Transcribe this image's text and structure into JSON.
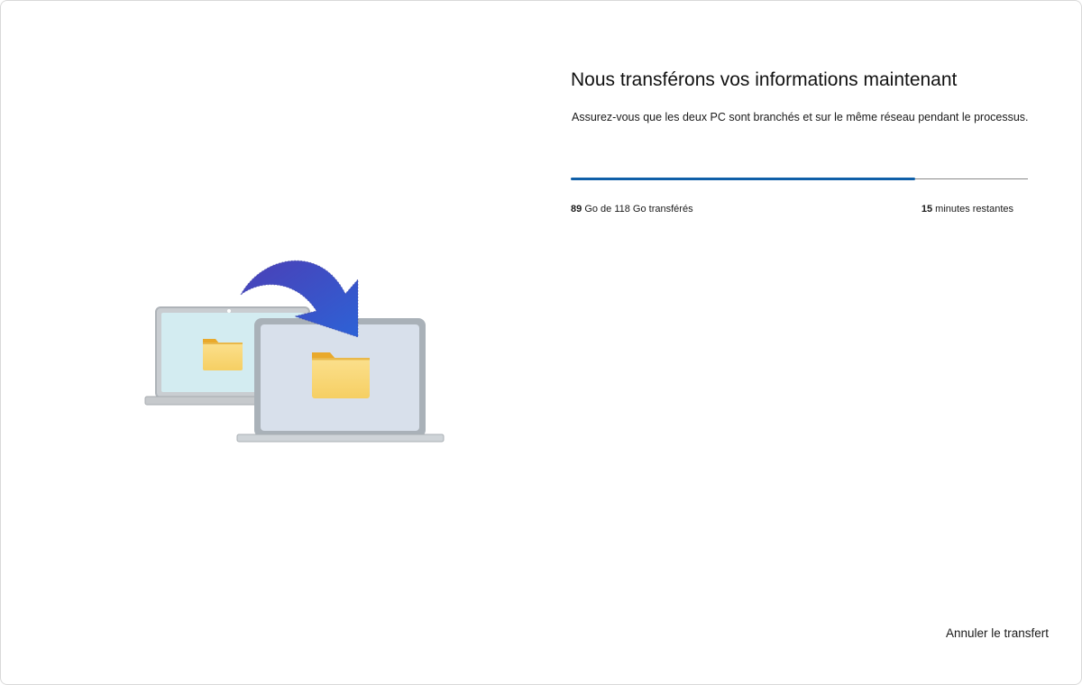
{
  "header": {
    "title": "Nous transférons vos informations maintenant",
    "subtitle": "Assurez-vous que les deux PC sont branchés et sur le même réseau pendant le processus."
  },
  "progress": {
    "fraction": 0.754,
    "transferred_amount": "89",
    "transferred_text": "Go de 118 Go transférés",
    "remaining_amount": "15",
    "remaining_text": "minutes restantes"
  },
  "footer": {
    "cancel_label": "Annuler le transfert"
  },
  "illustration": {
    "source_icon": "laptop-icon",
    "target_icon": "laptop-icon",
    "folder_icon": "folder-icon",
    "arrow_icon": "curved-arrow-icon",
    "colors": {
      "arrow_start": "#4b3fb6",
      "arrow_end": "#2d62d6",
      "progress_fill": "#0f5fa8",
      "folder": "#f8d675",
      "folder_tab": "#e9a92b"
    }
  }
}
